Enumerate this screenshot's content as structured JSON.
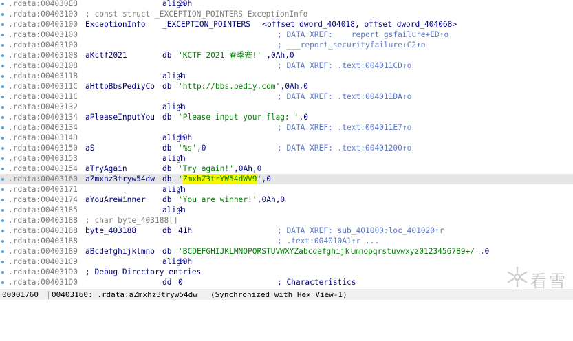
{
  "listing": [
    {
      "addr": ".rdata:004030E8",
      "label": "",
      "mnem": "align",
      "ops": [
        {
          "t": "20h",
          "k": "op"
        }
      ]
    },
    {
      "addr": ".rdata:00403100",
      "comment_line": "; const struct _EXCEPTION_POINTERS ExceptionInfo"
    },
    {
      "addr": ".rdata:00403100",
      "label": "ExceptionInfo",
      "mnem": "_EXCEPTION_POINTERS",
      "ops": [
        {
          "t": "<offset dword_404018, offset dword_404068>",
          "k": "op"
        }
      ]
    },
    {
      "addr": ".rdata:00403100",
      "xref": "; DATA XREF: ___report_gsfailure+ED↑o"
    },
    {
      "addr": ".rdata:00403100",
      "xref": "; ___report_securityfailure+C2↑o"
    },
    {
      "addr": ".rdata:00403108",
      "label": "aKctf2021",
      "mnem": "db",
      "ops": [
        {
          "t": "'KCTF 2021 春季赛!'",
          "k": "str"
        },
        {
          "t": ",0Ah,0",
          "k": "op"
        }
      ]
    },
    {
      "addr": ".rdata:00403108",
      "xref": "; DATA XREF: .text:004011CD↑o"
    },
    {
      "addr": ".rdata:0040311B",
      "label": "",
      "mnem": "align",
      "ops": [
        {
          "t": "4",
          "k": "op"
        }
      ]
    },
    {
      "addr": ".rdata:0040311C",
      "label": "aHttpBbsPediyCo",
      "mnem": "db",
      "ops": [
        {
          "t": "'http://bbs.pediy.com'",
          "k": "str"
        },
        {
          "t": ",0Ah,0",
          "k": "op"
        }
      ]
    },
    {
      "addr": ".rdata:0040311C",
      "xref": "; DATA XREF: .text:004011DA↑o"
    },
    {
      "addr": ".rdata:00403132",
      "label": "",
      "mnem": "align",
      "ops": [
        {
          "t": "4",
          "k": "op"
        }
      ]
    },
    {
      "addr": ".rdata:00403134",
      "label": "aPleaseInputYou",
      "mnem": "db",
      "ops": [
        {
          "t": "'Please input your flag: '",
          "k": "str"
        },
        {
          "t": ",0",
          "k": "op"
        }
      ]
    },
    {
      "addr": ".rdata:00403134",
      "xref": "; DATA XREF: .text:004011E7↑o"
    },
    {
      "addr": ".rdata:0040314D",
      "label": "",
      "mnem": "align",
      "ops": [
        {
          "t": "10h",
          "k": "op"
        }
      ]
    },
    {
      "addr": ".rdata:00403150",
      "label": "aS",
      "mnem": "db",
      "ops": [
        {
          "t": "'%s'",
          "k": "str"
        },
        {
          "t": ",0",
          "k": "op"
        }
      ],
      "xref": "; DATA XREF: .text:00401200↑o"
    },
    {
      "addr": ".rdata:00403153",
      "label": "",
      "mnem": "align",
      "ops": [
        {
          "t": "4",
          "k": "op"
        }
      ]
    },
    {
      "addr": ".rdata:00403154",
      "label": "aTryAgain",
      "mnem": "db",
      "ops": [
        {
          "t": "'Try again!'",
          "k": "str"
        },
        {
          "t": ",0Ah,0",
          "k": "op"
        }
      ]
    },
    {
      "addr": ".rdata:00403160",
      "label": "aZmxhz3tryw54dw",
      "mnem": "db",
      "selected": true,
      "ops": [
        {
          "t": "'",
          "k": "str"
        },
        {
          "t": "ZmxhZ3trYW54dWV9",
          "k": "hl"
        },
        {
          "t": "'",
          "k": "str"
        },
        {
          "t": ",0",
          "k": "op"
        }
      ]
    },
    {
      "addr": ".rdata:00403171",
      "label": "",
      "mnem": "align",
      "ops": [
        {
          "t": "4",
          "k": "op"
        }
      ]
    },
    {
      "addr": ".rdata:00403174",
      "label": "aYouAreWinner",
      "mnem": "db",
      "ops": [
        {
          "t": "'You are winner!'",
          "k": "str"
        },
        {
          "t": ",0Ah,0",
          "k": "op"
        }
      ]
    },
    {
      "addr": ".rdata:00403185",
      "label": "",
      "mnem": "align",
      "ops": [
        {
          "t": "4",
          "k": "op"
        }
      ]
    },
    {
      "addr": ".rdata:00403188",
      "comment_line": "; char byte_403188[]"
    },
    {
      "addr": ".rdata:00403188",
      "label": "byte_403188",
      "mnem": "db",
      "ops": [
        {
          "t": "41h",
          "k": "op"
        }
      ],
      "xref": "; DATA XREF: sub_401000:loc_401020↑r"
    },
    {
      "addr": ".rdata:00403188",
      "xref": "; .text:004010A1↑r ..."
    },
    {
      "addr": ".rdata:00403189",
      "label": "aBcdefghijklmno",
      "mnem": "db",
      "ops": [
        {
          "t": "'BCDEFGHIJKLMNOPQRSTUVWXYZabcdefghijklmnopqrstuvwxyz0123456789+/'",
          "k": "str"
        },
        {
          "t": ",0",
          "k": "op"
        }
      ]
    },
    {
      "addr": ".rdata:004031C9",
      "label": "",
      "mnem": "align",
      "ops": [
        {
          "t": "10h",
          "k": "op"
        }
      ]
    },
    {
      "addr": ".rdata:004031D0",
      "comment_line": "; Debug Directory entries",
      "comment_dark": true
    },
    {
      "addr": ".rdata:004031D0",
      "label": "",
      "mnem": "dd",
      "ops": [
        {
          "t": "0",
          "k": "op"
        }
      ],
      "xref": "; Characteristics",
      "xref_dark": true
    }
  ],
  "status": {
    "offset": "00001760",
    "location": "00403160: .rdata:aZmxhz3tryw54dw",
    "sync": "(Synchronized with Hex View-1)"
  },
  "watermark": {
    "text": "看雪",
    "icon": "snowflake-logo-icon"
  }
}
